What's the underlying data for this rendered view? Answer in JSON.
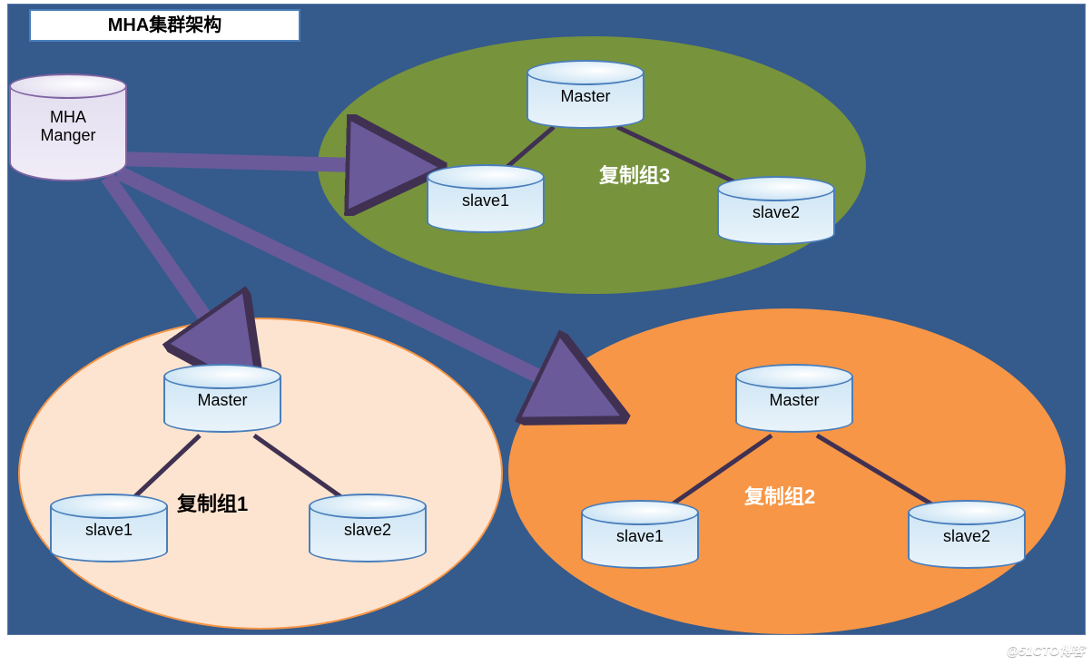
{
  "title": "MHA集群架构",
  "manager": {
    "label": "MHA\nManger"
  },
  "groups": [
    {
      "id": "g3",
      "label": "复制组3",
      "label_color": "#ffffff",
      "master": "Master",
      "slave1": "slave1",
      "slave2": "slave2"
    },
    {
      "id": "g1",
      "label": "复制组1",
      "label_color": "#000000",
      "master": "Master",
      "slave1": "slave1",
      "slave2": "slave2"
    },
    {
      "id": "g2",
      "label": "复制组2",
      "label_color": "#ffffff",
      "master": "Master",
      "slave1": "slave1",
      "slave2": "slave2"
    }
  ],
  "watermark": "@51CTO博客"
}
